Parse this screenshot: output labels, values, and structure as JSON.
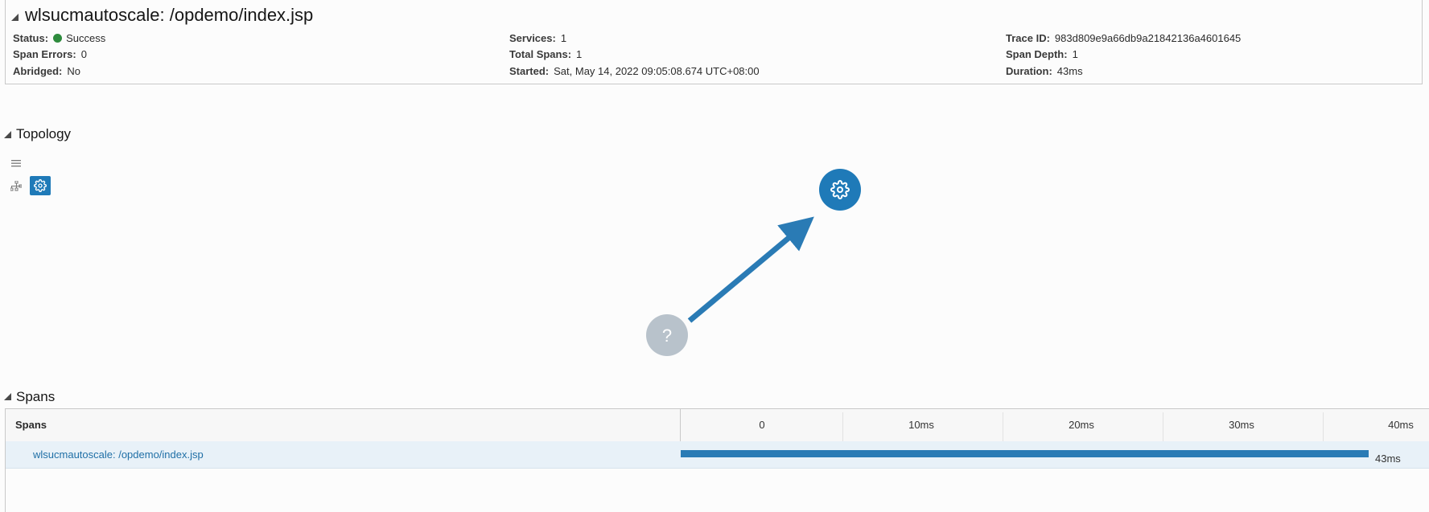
{
  "header": {
    "title": "wlsucmautoscale: /opdemo/index.jsp",
    "fields": {
      "status": {
        "label": "Status:",
        "value": "Success",
        "color": "#2e8b3d"
      },
      "span_errors": {
        "label": "Span Errors:",
        "value": "0"
      },
      "abridged": {
        "label": "Abridged:",
        "value": "No"
      },
      "services": {
        "label": "Services:",
        "value": "1"
      },
      "total_spans": {
        "label": "Total Spans:",
        "value": "1"
      },
      "started": {
        "label": "Started:",
        "value": "Sat, May 14, 2022 09:05:08.674 UTC+08:00"
      },
      "trace_id": {
        "label": "Trace ID:",
        "value": "983d809e9a66db9a21842136a4601645"
      },
      "span_depth": {
        "label": "Span Depth:",
        "value": "1"
      },
      "duration": {
        "label": "Duration:",
        "value": "43ms"
      }
    }
  },
  "topology": {
    "title": "Topology",
    "toolbar": [
      "list-view-icon",
      "hierarchy-view-icon",
      "gear-icon"
    ],
    "nodes": [
      {
        "name": "unknown-service",
        "icon": "question-icon",
        "color": "#b8c2cb"
      },
      {
        "name": "service",
        "icon": "gear-icon",
        "color": "#1f7ab8"
      }
    ],
    "edge_color": "#2a7bb5"
  },
  "spans": {
    "title": "Spans",
    "column_header": "Spans",
    "ticks": [
      "0",
      "10ms",
      "20ms",
      "30ms",
      "40ms"
    ],
    "rows": [
      {
        "name": "wlsucmautoscale: /opdemo/index.jsp",
        "duration": "43ms",
        "duration_ms": 43
      }
    ],
    "bar_color": "#2a7bb5",
    "row_selected_bg": "#e8f1f8"
  }
}
